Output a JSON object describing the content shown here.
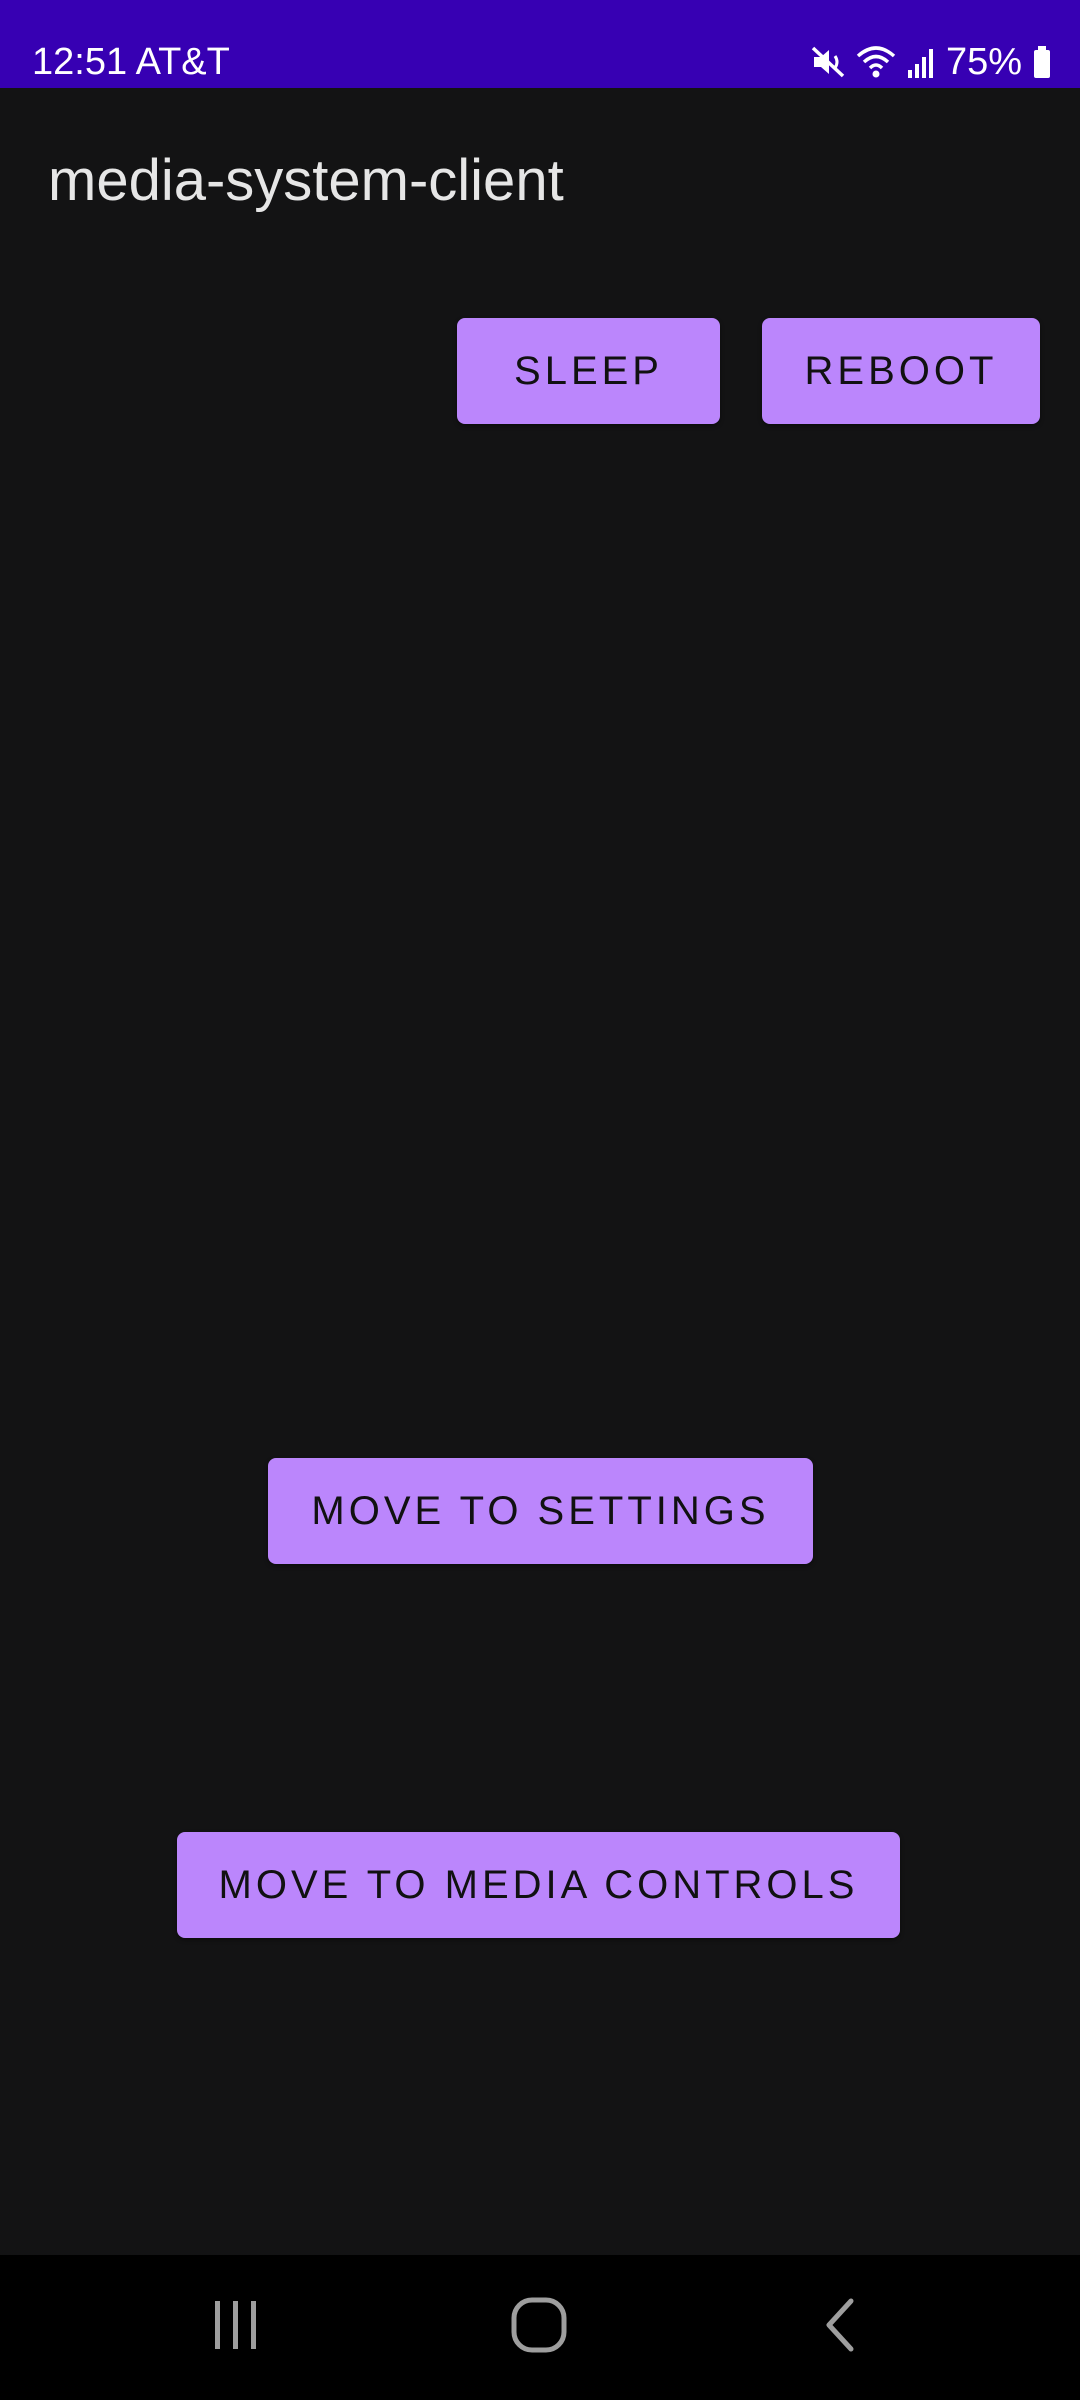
{
  "status_bar": {
    "time": "12:51",
    "carrier": "AT&T",
    "battery": "75%",
    "icons": [
      "mute-icon",
      "wifi-icon",
      "signal-icon",
      "battery-icon"
    ],
    "background": "#3700b3"
  },
  "app_bar": {
    "title": "media-system-client"
  },
  "buttons": {
    "sleep": "SLEEP",
    "reboot": "REBOOT",
    "settings": "MOVE TO SETTINGS",
    "media_controls": "MOVE TO MEDIA CONTROLS"
  },
  "colors": {
    "accent": "#bb86fc",
    "background": "#131314",
    "button_text": "#111111"
  },
  "nav_bar": {
    "icons": [
      "recents-icon",
      "home-icon",
      "back-icon"
    ]
  }
}
